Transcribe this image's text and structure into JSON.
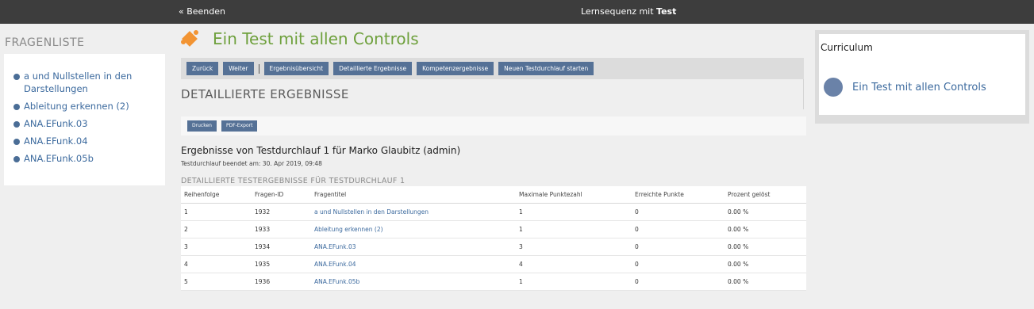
{
  "topbar": {
    "exit_label": "« Beenden",
    "title_prefix": "Lernsequenz mit ",
    "title_bold": "Test"
  },
  "fragenliste": {
    "title": "FRAGENLISTE",
    "items": [
      {
        "label": "a und Nullstellen in den Darstellungen"
      },
      {
        "label": "Ableitung erkennen (2)"
      },
      {
        "label": "ANA.EFunk.03"
      },
      {
        "label": "ANA.EFunk.04"
      },
      {
        "label": "ANA.EFunk.05b"
      }
    ]
  },
  "main": {
    "title": "Ein Test mit allen Controls",
    "toolbar": {
      "back": "Zurück",
      "next": "Weiter",
      "overview": "Ergebnisübersicht",
      "detailed": "Detaillierte Ergebnisse",
      "competence": "Kompetenzergebnisse",
      "new_run": "Neuen Testdurchlauf starten"
    },
    "section_title": "DETAILLIERTE ERGEBNISSE",
    "print": "Drucken",
    "pdf": "PDF-Export",
    "results_title": "Ergebnisse von Testdurchlauf 1 für Marko Glaubitz (admin)",
    "results_sub": "Testdurchlauf beendet am: 30. Apr 2019, 09:48",
    "results_caption": "DETAILLIERTE TESTERGEBNISSE FÜR TESTDURCHLAUF 1",
    "table": {
      "headers": [
        "Reihenfolge",
        "Fragen-ID",
        "Fragentitel",
        "Maximale Punktezahl",
        "Erreichte Punkte",
        "Prozent gelöst"
      ],
      "rows": [
        [
          "1",
          "1932",
          "a und Nullstellen in den Darstellungen",
          "1",
          "0",
          "0.00 %"
        ],
        [
          "2",
          "1933",
          "Ableitung erkennen (2)",
          "1",
          "0",
          "0.00 %"
        ],
        [
          "3",
          "1934",
          "ANA.EFunk.03",
          "3",
          "0",
          "0.00 %"
        ],
        [
          "4",
          "1935",
          "ANA.EFunk.04",
          "4",
          "0",
          "0.00 %"
        ],
        [
          "5",
          "1936",
          "ANA.EFunk.05b",
          "1",
          "0",
          "0.00 %"
        ]
      ]
    }
  },
  "curriculum": {
    "title": "Curriculum",
    "item_label": "Ein Test mit allen Controls"
  },
  "colors": {
    "accent_green": "#6ea03c",
    "button_blue": "#557196",
    "link_blue": "#3c6a9e",
    "puzzle_orange": "#f29433"
  },
  "icons": [
    "puzzle-icon",
    "bullet-icon",
    "curriculum-status-icon"
  ]
}
